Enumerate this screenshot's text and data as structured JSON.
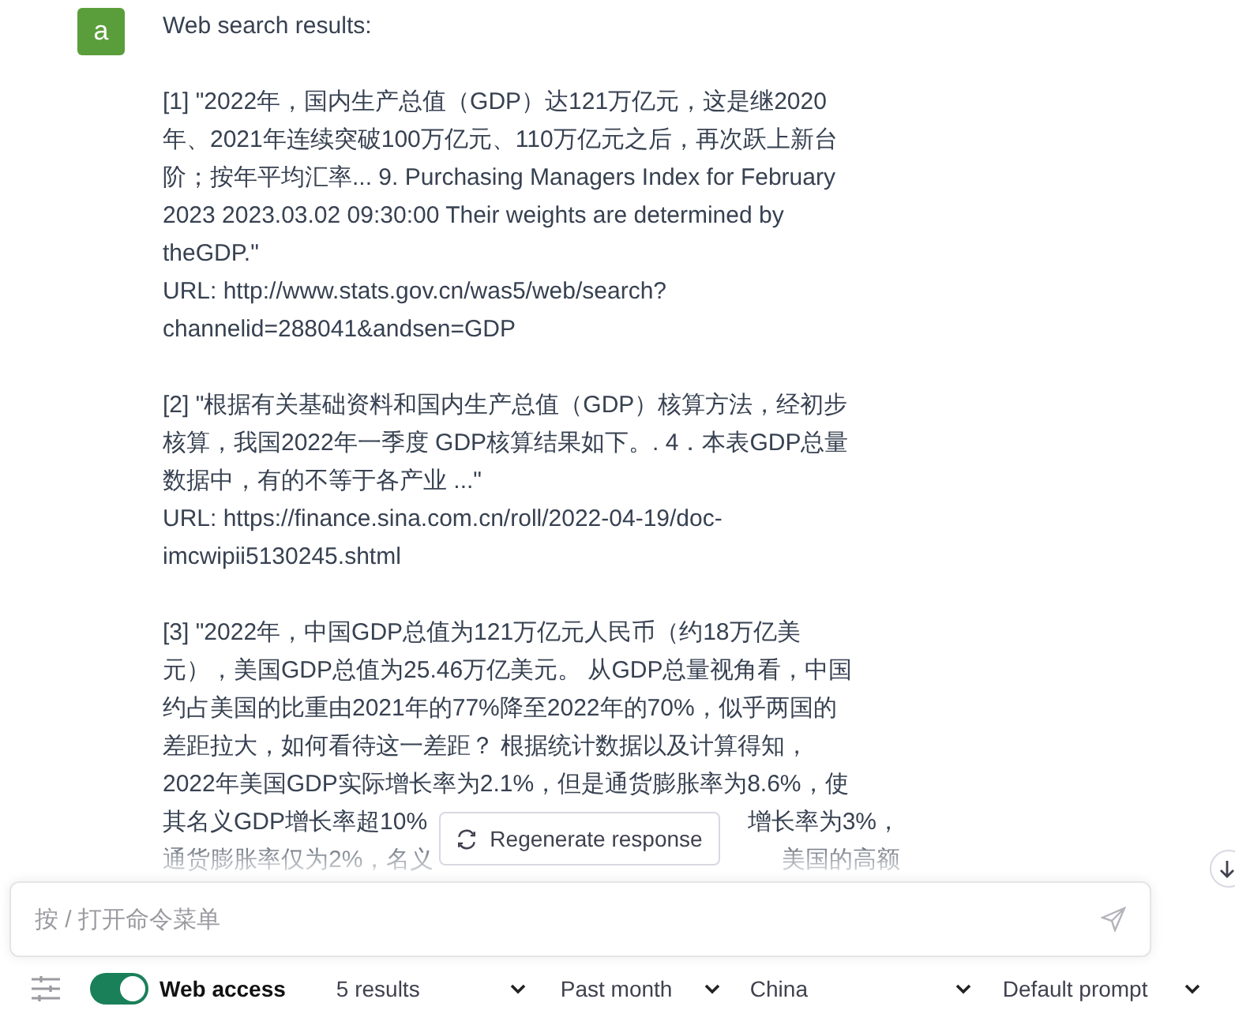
{
  "message": {
    "avatar": "a",
    "paragraphs": [
      {
        "lines": [
          [
            "Web search results:"
          ]
        ]
      },
      {
        "lines": [
          [
            "[1] \"2022年，国内生产总值（GDP）达121万亿元，这是继2020"
          ],
          [
            "年、2021年连续突破100万亿元、110万亿元之后，再次跃上新台"
          ],
          [
            "阶；按年平均汇率... 9. Purchasing Managers Index for February"
          ],
          [
            "2023 2023.03.02 09:30:00 Their weights are determined by"
          ],
          [
            "theGDP.\""
          ],
          [
            "URL: http://www.stats.gov.cn/was5/web/search?"
          ],
          [
            "channelid=288041&andsen=GDP"
          ]
        ]
      },
      {
        "lines": [
          [
            "[2] \"根据有关基础资料和国内生产总值（GDP）核算方法，经初步"
          ],
          [
            "核算，我国2022年一季度 GDP核算结果如下。. 4．本表GDP总量"
          ],
          [
            "数据中，有的不等于各产业 ...\""
          ],
          [
            "URL: https://finance.sina.com.cn/roll/2022-04-19/doc-"
          ],
          [
            "imcwipii5130245.shtml"
          ]
        ]
      },
      {
        "lines": [
          [
            "[3] \"2022年，中国GDP总值为121万亿元人民币（约18万亿美"
          ],
          [
            "元），美国GDP总值为25.46万亿美元。 从GDP总量视角看，中国"
          ],
          [
            "约占美国的比重由2021年的77%降至2022年的70%，似乎两国的"
          ],
          [
            "差距拉大，如何看待这一差距？ 根据统计数据以及计算得知，"
          ],
          [
            "2022年美国GDP实际增长率为2.1%，但是通货膨胀率为8.6%，使"
          ],
          [
            "其名义GDP增长率超10%",
            "增长率为3%，"
          ],
          [
            "通货膨胀率仅为2%，名义",
            "美国的高额"
          ]
        ]
      }
    ]
  },
  "regenerate_button": {
    "label": "Regenerate response"
  },
  "input": {
    "placeholder": "按 / 打开命令菜单"
  },
  "toolbar": {
    "web_access": {
      "label": "Web access",
      "on": true
    },
    "dropdowns": [
      {
        "value": "5 results"
      },
      {
        "value": "Past month"
      },
      {
        "value": "China"
      },
      {
        "value": "Default prompt"
      }
    ]
  }
}
